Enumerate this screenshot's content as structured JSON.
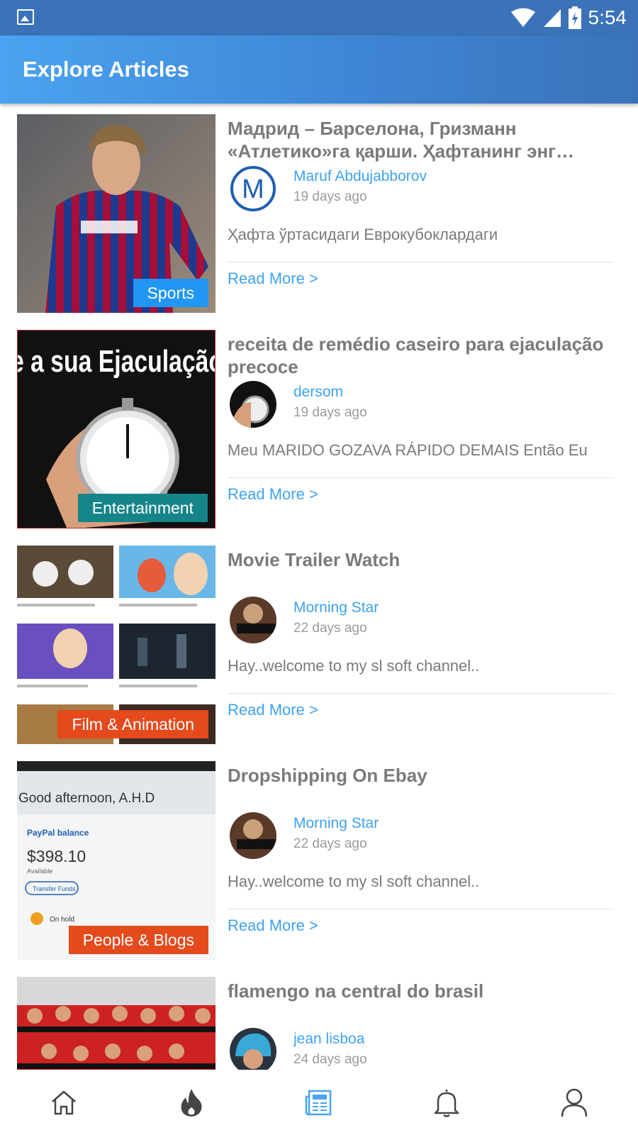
{
  "status_bar": {
    "time": "5:54"
  },
  "app_bar": {
    "title": "Explore Articles"
  },
  "articles": [
    {
      "title": "Мадрид – Барселона, Гризманн «Атлетико»га қарши. Ҳафтанинг энг…",
      "author": "Maruf Abdujabborov",
      "date": "19 days ago",
      "excerpt": "Ҳафта ўртасидаги Еврокубоклардаги",
      "category": "Sports",
      "category_color": "#2196f3",
      "read_more": "Read More >"
    },
    {
      "title": "receita de remédio caseiro para ejaculação precoce",
      "author": "dersom",
      "date": "19 days ago",
      "excerpt": "Meu MARIDO GOZAVA RÁPIDO DEMAIS Então Eu",
      "category": "Entertainment",
      "category_color": "#16858a",
      "thumb_text": "e a sua Ejaculação",
      "read_more": "Read More >"
    },
    {
      "title": "Movie Trailer Watch",
      "author": "Morning Star",
      "date": "22 days ago",
      "excerpt": "Hay..welcome to my sl soft  channel..",
      "category": "Film & Animation",
      "category_color": "#e44a1c",
      "read_more": "Read More >"
    },
    {
      "title": "Dropshipping On Ebay",
      "author": "Morning Star",
      "date": "22 days ago",
      "excerpt": "Hay..welcome to my sl soft  channel..",
      "category": "People & Blogs",
      "category_color": "#e44a1c",
      "thumb_lines": [
        "Good afternoon, A.H.D",
        "PayPal balance",
        "$398.10",
        "Available",
        "Transfer Funds",
        "On hold"
      ],
      "read_more": "Read More >"
    },
    {
      "title": "flamengo na central do brasil",
      "author": "jean lisboa",
      "date": "24 days ago",
      "excerpt": "",
      "category": "",
      "category_color": "",
      "read_more": ""
    }
  ],
  "bottom_nav": [
    "home-icon",
    "flame-icon",
    "newspaper-icon",
    "bell-icon",
    "user-icon"
  ],
  "colors": {
    "accent": "#3ea2f1",
    "appbar": "#3f86d6",
    "statusbar": "#3a73b8",
    "nav_active": "#4aa3f0",
    "nav_inactive": "#444444"
  }
}
